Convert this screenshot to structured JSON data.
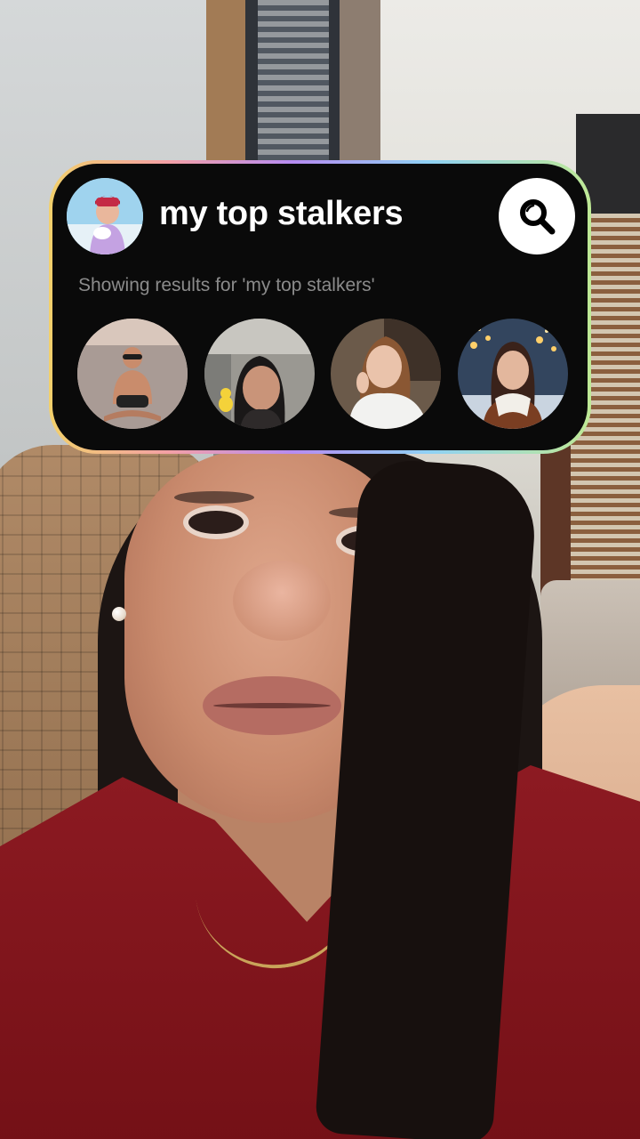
{
  "overlay": {
    "query": "my top stalkers",
    "results_caption": "Showing results for 'my top stalkers'",
    "search_icon": "magnifier-icon",
    "user_avatar": "user-avatar-winter-photo",
    "results": [
      {
        "avatar": "profile-photo-boy-on-beach"
      },
      {
        "avatar": "profile-photo-woman-indoors"
      },
      {
        "avatar": "profile-photo-woman-white-top"
      },
      {
        "avatar": "profile-photo-woman-scarf-night"
      }
    ]
  },
  "colors": {
    "card_background": "#0a0a0a",
    "query_text": "#ffffff",
    "caption_text": "#8b8b8b",
    "border_gradient": [
      "#f2d06b",
      "#f4a0a6",
      "#b68cf2",
      "#8fd1f5",
      "#bfe995"
    ]
  }
}
